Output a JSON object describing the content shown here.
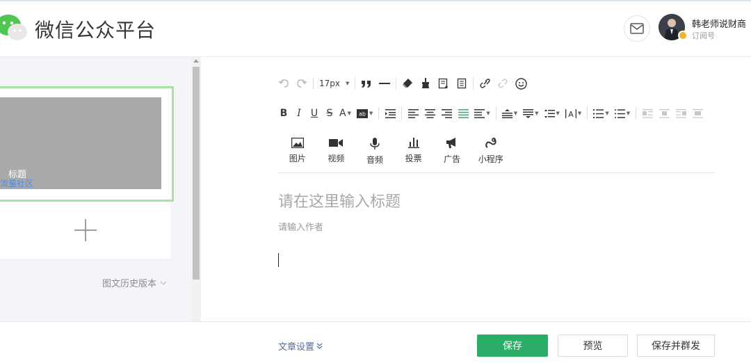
{
  "header": {
    "app_title": "微信公众平台",
    "account_name": "韩老师说财商",
    "account_type": "订阅号"
  },
  "left_panel": {
    "cover_title": "标题",
    "cover_link": "流量社区",
    "history_label": "图文历史版本"
  },
  "toolbar": {
    "font_size": "17px"
  },
  "media": [
    {
      "label": "图片",
      "icon": "image-icon"
    },
    {
      "label": "视频",
      "icon": "video-icon"
    },
    {
      "label": "音频",
      "icon": "audio-icon"
    },
    {
      "label": "投票",
      "icon": "vote-icon"
    },
    {
      "label": "广告",
      "icon": "ad-icon"
    },
    {
      "label": "小程序",
      "icon": "mini-program-icon"
    }
  ],
  "editor": {
    "title_placeholder": "请在这里输入标题",
    "author_placeholder": "请输入作者"
  },
  "footer": {
    "settings_label": "文章设置",
    "save_label": "保存",
    "preview_label": "预览",
    "publish_label": "保存并群发"
  },
  "colors": {
    "primary": "#2aae67",
    "active_icon": "#2aae67",
    "card_border": "#a9e0a3",
    "link": "#576b95"
  }
}
